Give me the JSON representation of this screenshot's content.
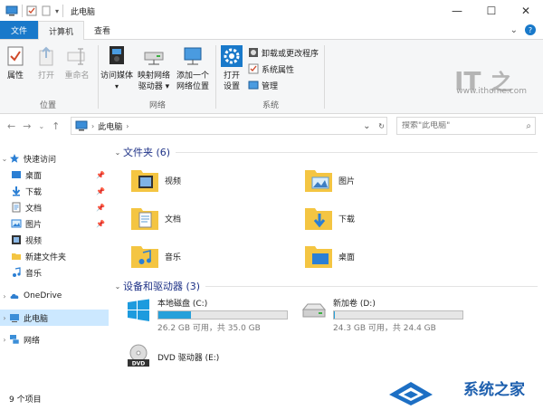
{
  "window": {
    "title": "此电脑",
    "minimize": "—",
    "maximize": "☐",
    "close": "✕"
  },
  "tabs": [
    {
      "label": "文件"
    },
    {
      "label": "计算机"
    },
    {
      "label": "查看"
    }
  ],
  "ribbon": {
    "location": {
      "label": "位置",
      "properties": "属性",
      "open": "打开",
      "rename": "重命名"
    },
    "network": {
      "label": "网络",
      "media_1": "访问媒体",
      "map_drive_1": "映射网络",
      "map_drive_2": "驱动器 ▾",
      "add_location_1": "添加一个",
      "add_location_2": "网络位置"
    },
    "system": {
      "label": "系统",
      "settings_1": "打开",
      "settings_2": "设置",
      "uninstall": "卸载或更改程序",
      "sys_props": "系统属性",
      "manage": "管理"
    }
  },
  "brand": {
    "text": "IT之家",
    "url": "www.ithome.com"
  },
  "address": {
    "crumb": "此电脑",
    "search_placeholder": "搜索\"此电脑\""
  },
  "nav": {
    "quick_access": "快速访问",
    "items": [
      {
        "label": "桌面",
        "pinned": true
      },
      {
        "label": "下载",
        "pinned": true
      },
      {
        "label": "文档",
        "pinned": true
      },
      {
        "label": "图片",
        "pinned": true
      },
      {
        "label": "视频",
        "pinned": false
      },
      {
        "label": "新建文件夹",
        "pinned": false
      },
      {
        "label": "音乐",
        "pinned": false
      }
    ],
    "onedrive": "OneDrive",
    "this_pc": "此电脑",
    "network": "网络"
  },
  "content": {
    "folders_title": "文件夹 (6)",
    "folders": [
      {
        "name": "视频",
        "icon": "video-folder-icon"
      },
      {
        "name": "图片",
        "icon": "pictures-folder-icon"
      },
      {
        "name": "文档",
        "icon": "documents-folder-icon"
      },
      {
        "name": "下载",
        "icon": "downloads-folder-icon"
      },
      {
        "name": "音乐",
        "icon": "music-folder-icon"
      },
      {
        "name": "桌面",
        "icon": "desktop-folder-icon"
      }
    ],
    "drives_title": "设备和驱动器 (3)",
    "drives": [
      {
        "name": "本地磁盘 (C:)",
        "free": "26.2 GB 可用，共 35.0 GB",
        "used_fraction": 0.25
      },
      {
        "name": "新加卷 (D:)",
        "free": "24.3 GB 可用，共 24.4 GB",
        "used_fraction": 0.004
      },
      {
        "name": "DVD 驱动器 (E:)"
      }
    ]
  },
  "status": {
    "count": "9 个项目"
  },
  "watermark": {
    "text": "系统之家"
  },
  "colors": {
    "accent": "#1979ca",
    "selection": "#cce8ff",
    "drive_fill": "#26a0da",
    "section_title": "#1e3287"
  }
}
